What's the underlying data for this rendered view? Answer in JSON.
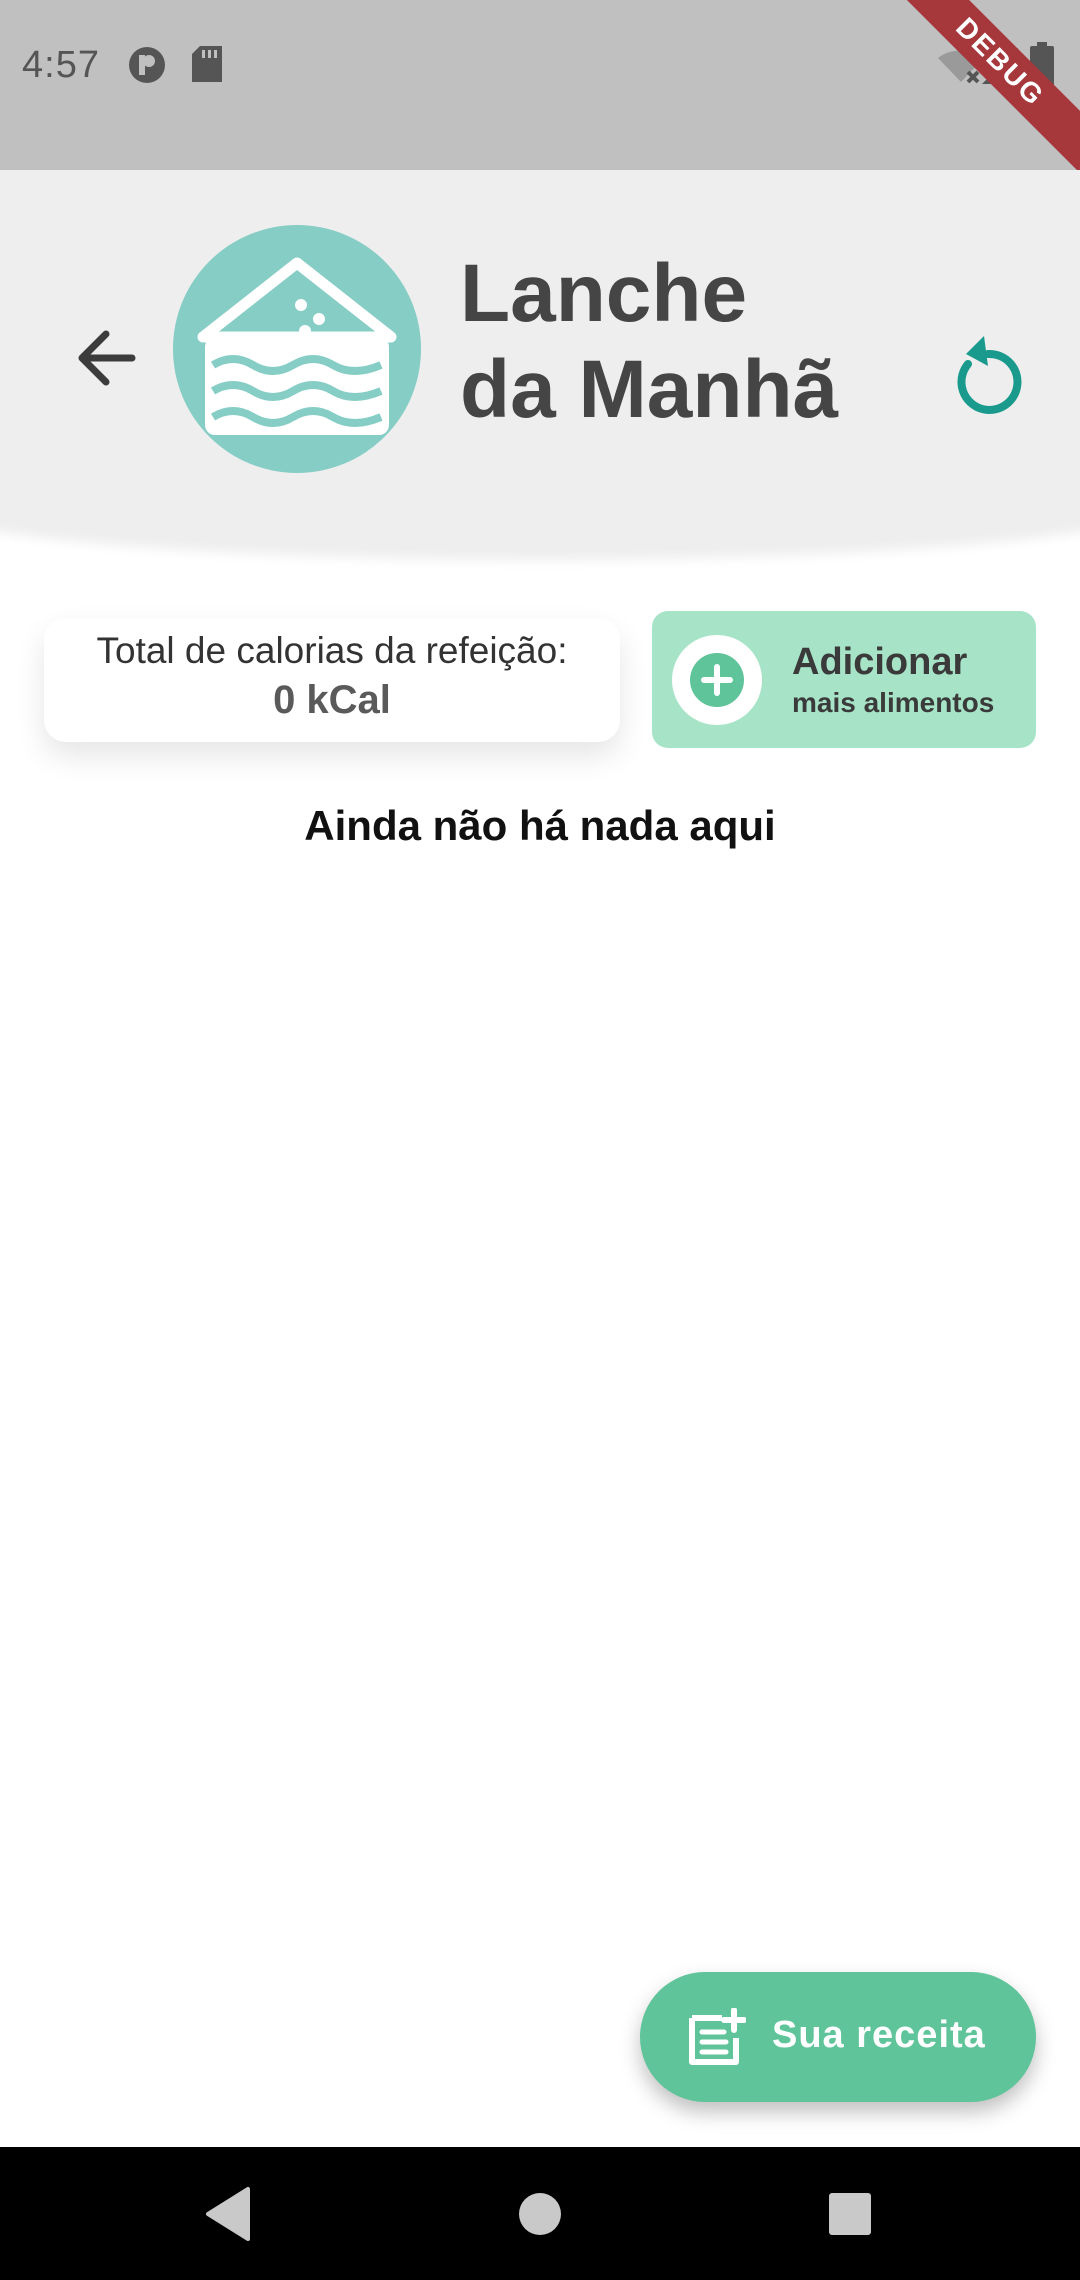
{
  "status_bar": {
    "time": "4:57",
    "icons": [
      "notification-p-icon",
      "sd-card-icon",
      "wifi-off-icon",
      "signal-icon",
      "battery-icon"
    ],
    "debug_banner": "DEBUG",
    "background": "#c0c0c0"
  },
  "header": {
    "back_icon": "arrow-left-icon",
    "meal_icon": "cake-slice-icon",
    "title_line1": "Lanche",
    "title_line2": "da Manhã",
    "reset_icon": "refresh-icon",
    "accent_color": "#199a8c",
    "avatar_color": "#85cdc5"
  },
  "calories": {
    "label": "Total de calorias da refeição:",
    "value": "0 kCal"
  },
  "add_foods": {
    "label": "Adicionar",
    "sublabel": "mais alimentos",
    "icon": "plus-circle-icon",
    "color": "#a7e3c7",
    "icon_color": "#5fc49a"
  },
  "empty_state": {
    "text": "Ainda não há nada aqui"
  },
  "fab": {
    "label": "Sua receita",
    "icon": "note-add-icon",
    "color": "#5fc49a"
  },
  "nav_bar": {
    "buttons": [
      "back-triangle-icon",
      "home-circle-icon",
      "recents-square-icon"
    ]
  }
}
